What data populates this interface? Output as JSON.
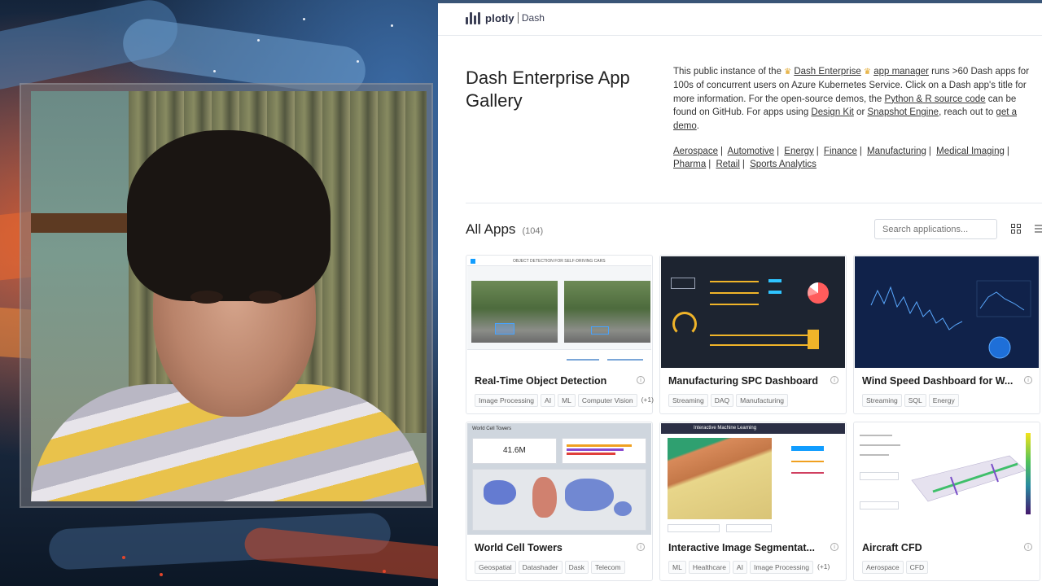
{
  "header": {
    "logo_text": "plotly",
    "product": "Dash"
  },
  "hero": {
    "title": "Dash Enterprise App Gallery",
    "intro": {
      "p1": "This public instance of the",
      "link_enterprise": "Dash Enterprise",
      "link_app_manager": "app manager",
      "p2": "runs >60 Dash apps for 100s of concurrent users on Azure Kubernetes Service.  Click on a Dash app's title for more information. For the open-source demos, the",
      "link_source": "Python & R source code",
      "p3": "can be found on GitHub.  For apps using",
      "link_design_kit": "Design Kit",
      "or": "or",
      "link_snapshot": "Snapshot Engine",
      "p4": ", reach out to",
      "link_demo": "get a demo",
      "end": "."
    },
    "industries": [
      "Aerospace",
      "Automotive",
      "Energy",
      "Finance",
      "Manufacturing",
      "Medical Imaging",
      "Pharma",
      "Retail",
      "Sports Analytics"
    ]
  },
  "apps_header": {
    "title": "All Apps",
    "count": "(104)"
  },
  "search": {
    "placeholder": "Search applications..."
  },
  "cards": [
    {
      "title": "Real-Time Object Detection",
      "tags": [
        "Image Processing",
        "AI",
        "ML",
        "Computer Vision"
      ],
      "more": "(+1)",
      "thumb_caption": "OBJECT DETECTION FOR SELF-DRIVING CARS"
    },
    {
      "title": "Manufacturing SPC Dashboard",
      "tags": [
        "Streaming",
        "DAQ",
        "Manufacturing"
      ],
      "more": ""
    },
    {
      "title": "Wind Speed Dashboard for W...",
      "tags": [
        "Streaming",
        "SQL",
        "Energy"
      ],
      "more": ""
    },
    {
      "title": "World Cell Towers",
      "tags": [
        "Geospatial",
        "Datashader",
        "Dask",
        "Telecom"
      ],
      "more": "",
      "thumb_caption": "World Cell Towers",
      "thumb_value": "41.6M"
    },
    {
      "title": "Interactive Image Segmentat...",
      "tags": [
        "ML",
        "Healthcare",
        "AI",
        "Image Processing"
      ],
      "more": "(+1)",
      "thumb_caption": "Interactive Machine Learning"
    },
    {
      "title": "Aircraft CFD",
      "tags": [
        "Aerospace",
        "CFD"
      ],
      "more": ""
    }
  ],
  "colors": {
    "accent": "#119dff",
    "brand_dark": "#2b2f45",
    "card_border": "#e3e6eb"
  }
}
